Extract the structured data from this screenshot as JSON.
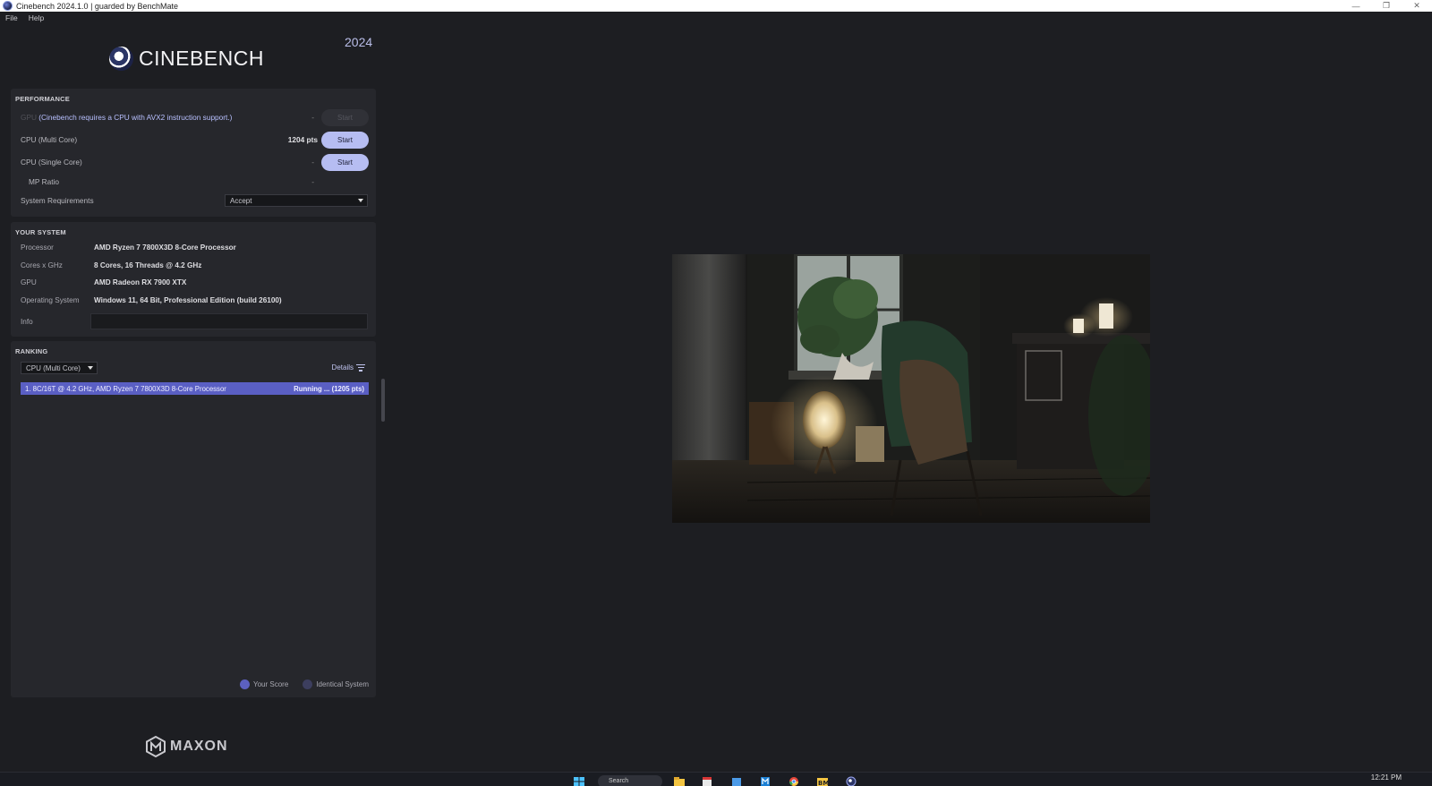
{
  "window": {
    "title": "Cinebench 2024.1.0 | guarded by BenchMate",
    "controls": [
      "—",
      "❐",
      "✕"
    ]
  },
  "menu": [
    "File",
    "Help"
  ],
  "brand": {
    "logo_text": "CINEBENCH",
    "year": "2024",
    "footer_logo": "MAXON"
  },
  "performance": {
    "title": "PERFORMANCE",
    "gpu": {
      "label": "GPU",
      "message": "(Cinebench requires a CPU with AVX2 instruction support.)",
      "score": "-",
      "button": "Start"
    },
    "multi": {
      "label": "CPU (Multi Core)",
      "score": "1204 pts",
      "button": "Start"
    },
    "single": {
      "label": "CPU (Single Core)",
      "score": "-",
      "button": "Start"
    },
    "mp_ratio": {
      "label": "MP Ratio",
      "score": "-"
    },
    "sysreq": {
      "label": "System Requirements",
      "value": "Accept"
    }
  },
  "system": {
    "title": "YOUR SYSTEM",
    "rows": [
      {
        "key": "Processor",
        "value": "AMD Ryzen 7 7800X3D 8-Core Processor"
      },
      {
        "key": "Cores x GHz",
        "value": "8 Cores, 16 Threads @ 4.2 GHz"
      },
      {
        "key": "GPU",
        "value": "AMD Radeon RX 7900 XTX"
      },
      {
        "key": "Operating System",
        "value": "Windows 11, 64 Bit, Professional Edition (build 26100)"
      }
    ],
    "info_label": "Info",
    "info_value": ""
  },
  "ranking": {
    "title": "RANKING",
    "filter": "CPU (Multi Core)",
    "details": "Details",
    "item": {
      "name": "1. 8C/16T @ 4.2 GHz, AMD Ryzen 7 7800X3D 8-Core Processor",
      "status": "Running ... (1205 pts)"
    },
    "legend_you": "Your Score",
    "legend_same": "Identical System"
  },
  "taskbar": {
    "search": "Search",
    "clock": "12:21 PM"
  },
  "colors": {
    "accent": "#b6bdf2",
    "rank_highlight": "#5a5fc4",
    "background": "#1d1e22",
    "panel": "#26272c"
  }
}
